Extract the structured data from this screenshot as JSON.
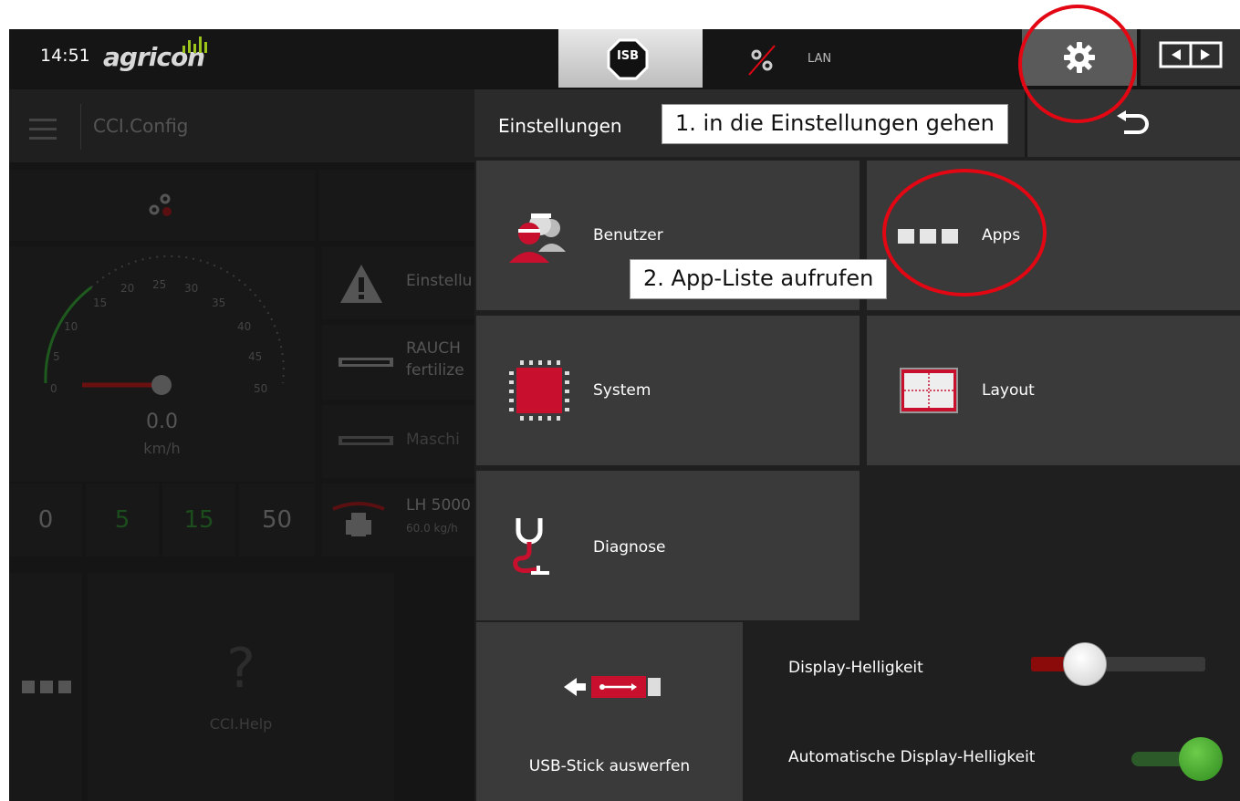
{
  "status_bar": {
    "time": "14:51",
    "logo_text": "agricon",
    "isb_label": "ISB",
    "lan_label": "LAN"
  },
  "left_panel": {
    "app_title": "CCI.Config",
    "speed_value": "0.0",
    "speed_unit": "km/h",
    "gauge_ticks": [
      "0",
      "5",
      "10",
      "15",
      "20",
      "25",
      "30",
      "35",
      "40",
      "45",
      "50"
    ],
    "range_buttons": [
      "0",
      "5",
      "15",
      "50"
    ],
    "list_items": [
      {
        "title": "Einstellu",
        "sub": ""
      },
      {
        "title": "RAUCH",
        "sub": "fertilize"
      },
      {
        "title": "Maschi",
        "sub": ""
      },
      {
        "title": "LH 5000",
        "sub": "60.0 kg/h"
      }
    ],
    "help_label": "CCI.Help",
    "help_glyph": "?"
  },
  "settings": {
    "header_title": "Einstellungen",
    "tiles": {
      "benutzer": "Benutzer",
      "apps": "Apps",
      "system": "System",
      "layout": "Layout",
      "diagnose": "Diagnose",
      "usb": "USB-Stick auswerfen"
    },
    "brightness_label": "Display-Helligkeit",
    "brightness_level": 0.31,
    "auto_brightness_label": "Automatische Display-Helligkeit",
    "auto_brightness_on": true
  },
  "annotations": {
    "step1": "1. in die Einstellungen gehen",
    "step2": "2. App-Liste aufrufen"
  },
  "colors": {
    "accent_red": "#e30613",
    "toggle_green": "#3fa535",
    "tile_bg": "#3a3a3a"
  },
  "icons": [
    "gear-icon",
    "swap-screen-icon",
    "back-arrow-icon",
    "user-group-icon",
    "apps-grid-icon",
    "chip-icon",
    "layout-icon",
    "stethoscope-icon",
    "usb-eject-icon",
    "gps-off-icon",
    "isb-icon",
    "warning-icon",
    "implement-icon",
    "tractor-icon",
    "help-icon",
    "hamburger-icon"
  ]
}
